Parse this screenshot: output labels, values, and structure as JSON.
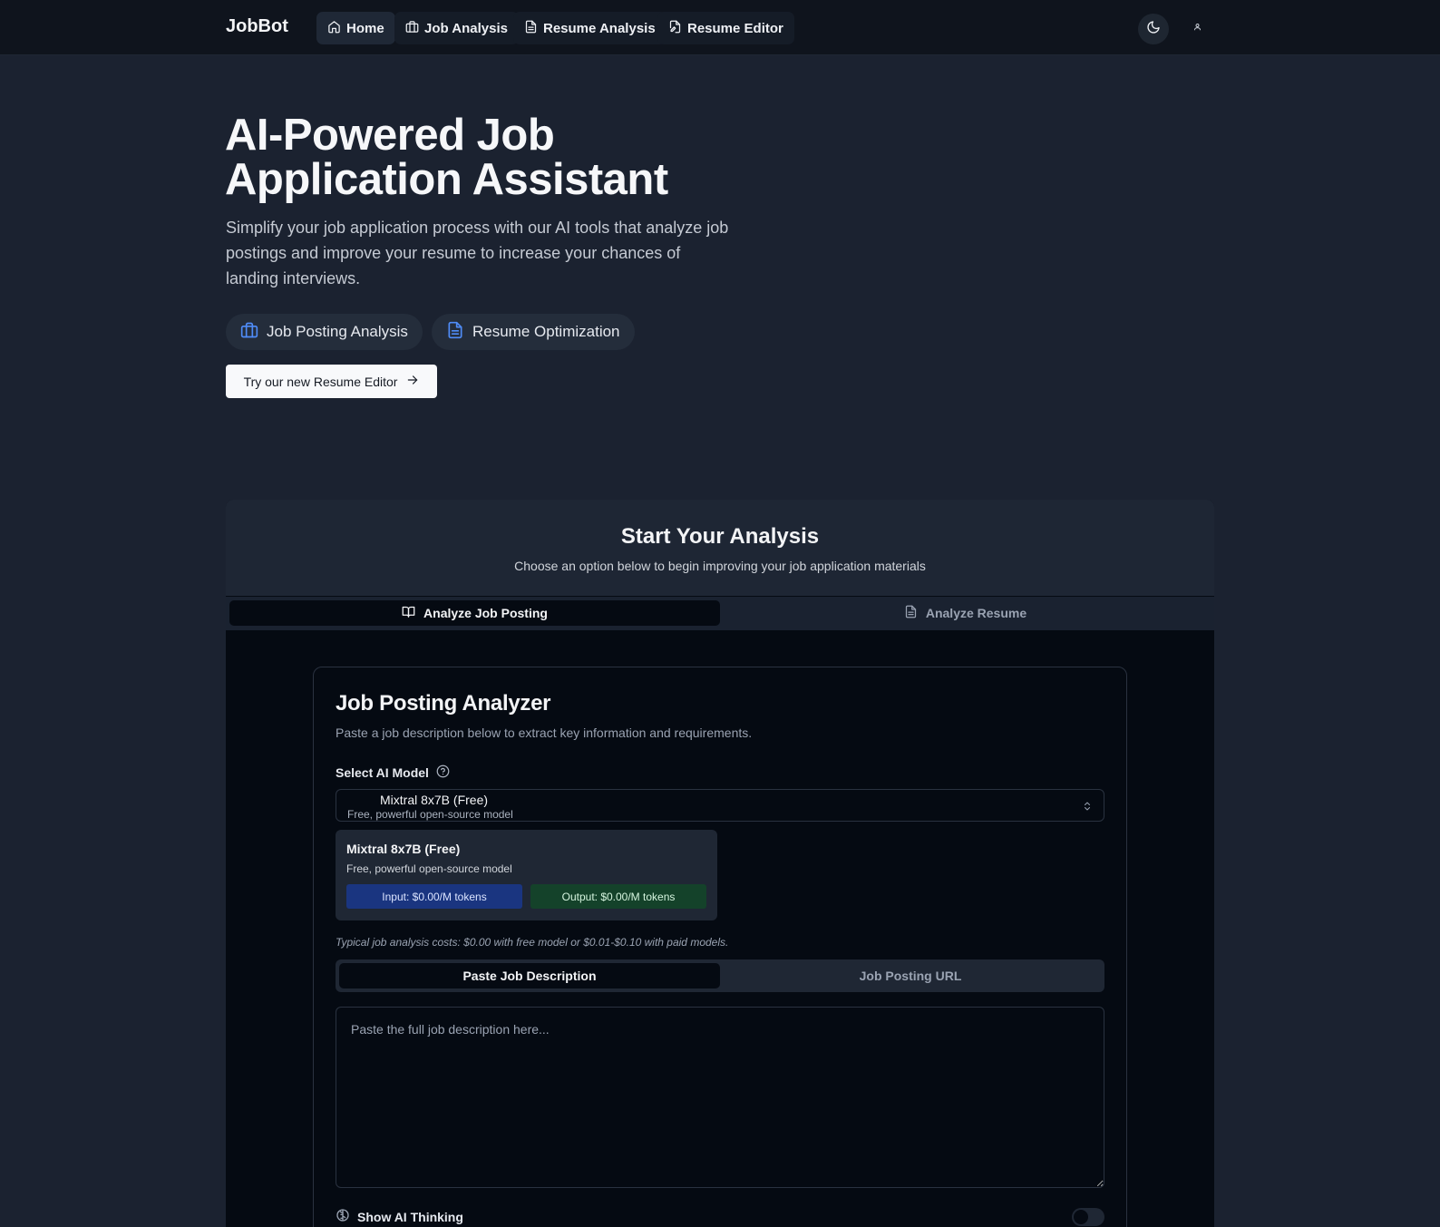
{
  "nav": {
    "brand": "JobBot",
    "items": [
      {
        "label": "Home",
        "icon": "home-icon"
      },
      {
        "label": "Job Analysis",
        "icon": "briefcase-icon"
      },
      {
        "label": "Resume Analysis",
        "icon": "file-text-icon"
      },
      {
        "label": "Resume Editor",
        "icon": "file-edit-icon"
      }
    ],
    "theme_icon": "moon-icon",
    "user_icon": "user-icon"
  },
  "hero": {
    "title": "AI-Powered Job Application Assistant",
    "subtitle": "Simplify your job application process with our AI tools that analyze job postings and improve your resume to increase your chances of landing interviews.",
    "features": [
      {
        "label": "Job Posting Analysis",
        "icon": "briefcase-icon"
      },
      {
        "label": "Resume Optimization",
        "icon": "file-text-icon"
      }
    ],
    "cta_label": "Try our new Resume Editor",
    "cta_icon": "arrow-right-icon"
  },
  "analysis": {
    "title": "Start Your Analysis",
    "subtitle": "Choose an option below to begin improving your job application materials",
    "tabs": [
      {
        "label": "Analyze Job Posting",
        "icon": "book-open-icon",
        "active": true
      },
      {
        "label": "Analyze Resume",
        "icon": "file-text-icon",
        "active": false
      }
    ]
  },
  "analyzer": {
    "title": "Job Posting Analyzer",
    "subtitle": "Paste a job description below to extract key information and requirements.",
    "model_label": "Select AI Model",
    "model_help_icon": "help-circle-icon",
    "selected_model": {
      "name": "Mixtral 8x7B (Free)",
      "description": "Free, powerful open-source model"
    },
    "model_info": {
      "name": "Mixtral 8x7B (Free)",
      "description": "Free, powerful open-source model",
      "input_price": "Input: $0.00/M tokens",
      "output_price": "Output: $0.00/M tokens"
    },
    "cost_note": "Typical job analysis costs: $0.00 with free model or $0.01-$0.10 with paid models.",
    "input_tabs": [
      {
        "label": "Paste Job Description",
        "active": true
      },
      {
        "label": "Job Posting URL",
        "active": false
      }
    ],
    "textarea_placeholder": "Paste the full job description here...",
    "textarea_value": "",
    "show_thinking_label": "Show AI Thinking",
    "show_thinking_icon": "brain-icon",
    "show_thinking_enabled": false
  },
  "colors": {
    "background": "#1b2230",
    "topbar": "#0f141d",
    "panel": "#050a12",
    "input_badge": "#1a3580",
    "output_badge": "#14422a",
    "accent_icon": "#4f8cf7"
  }
}
